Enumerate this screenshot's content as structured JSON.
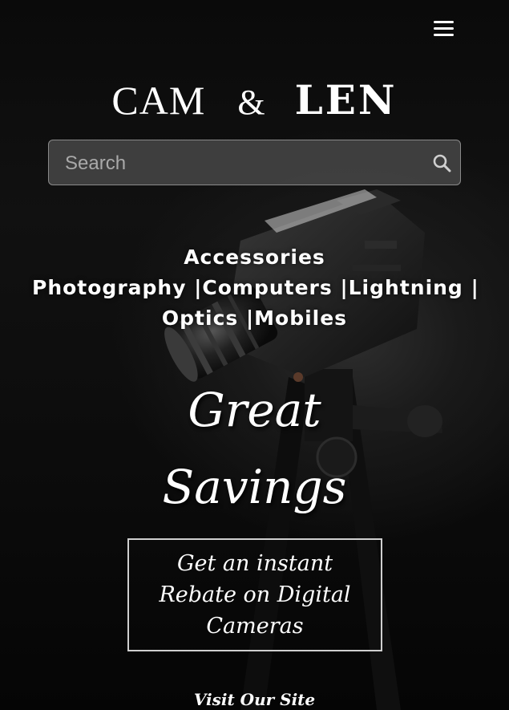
{
  "header": {
    "menu_icon": "hamburger-menu-icon",
    "logo": {
      "part1": "CAM",
      "ampersand": "&",
      "part2": "LEN"
    }
  },
  "search": {
    "placeholder": "Search",
    "value": "",
    "icon": "search-icon"
  },
  "categories": {
    "line1": "Accessories",
    "items": [
      {
        "label": "Photography"
      },
      {
        "label": "Computers"
      },
      {
        "label": "Lightning"
      },
      {
        "label": "Optics"
      },
      {
        "label": "Mobiles"
      }
    ],
    "separator": "|"
  },
  "hero": {
    "line1": "Great",
    "line2": "Savings"
  },
  "promo": {
    "text": "Get an instant Rebate on Digital Cameras"
  },
  "footer": {
    "visit_link": "Visit Our Site"
  }
}
